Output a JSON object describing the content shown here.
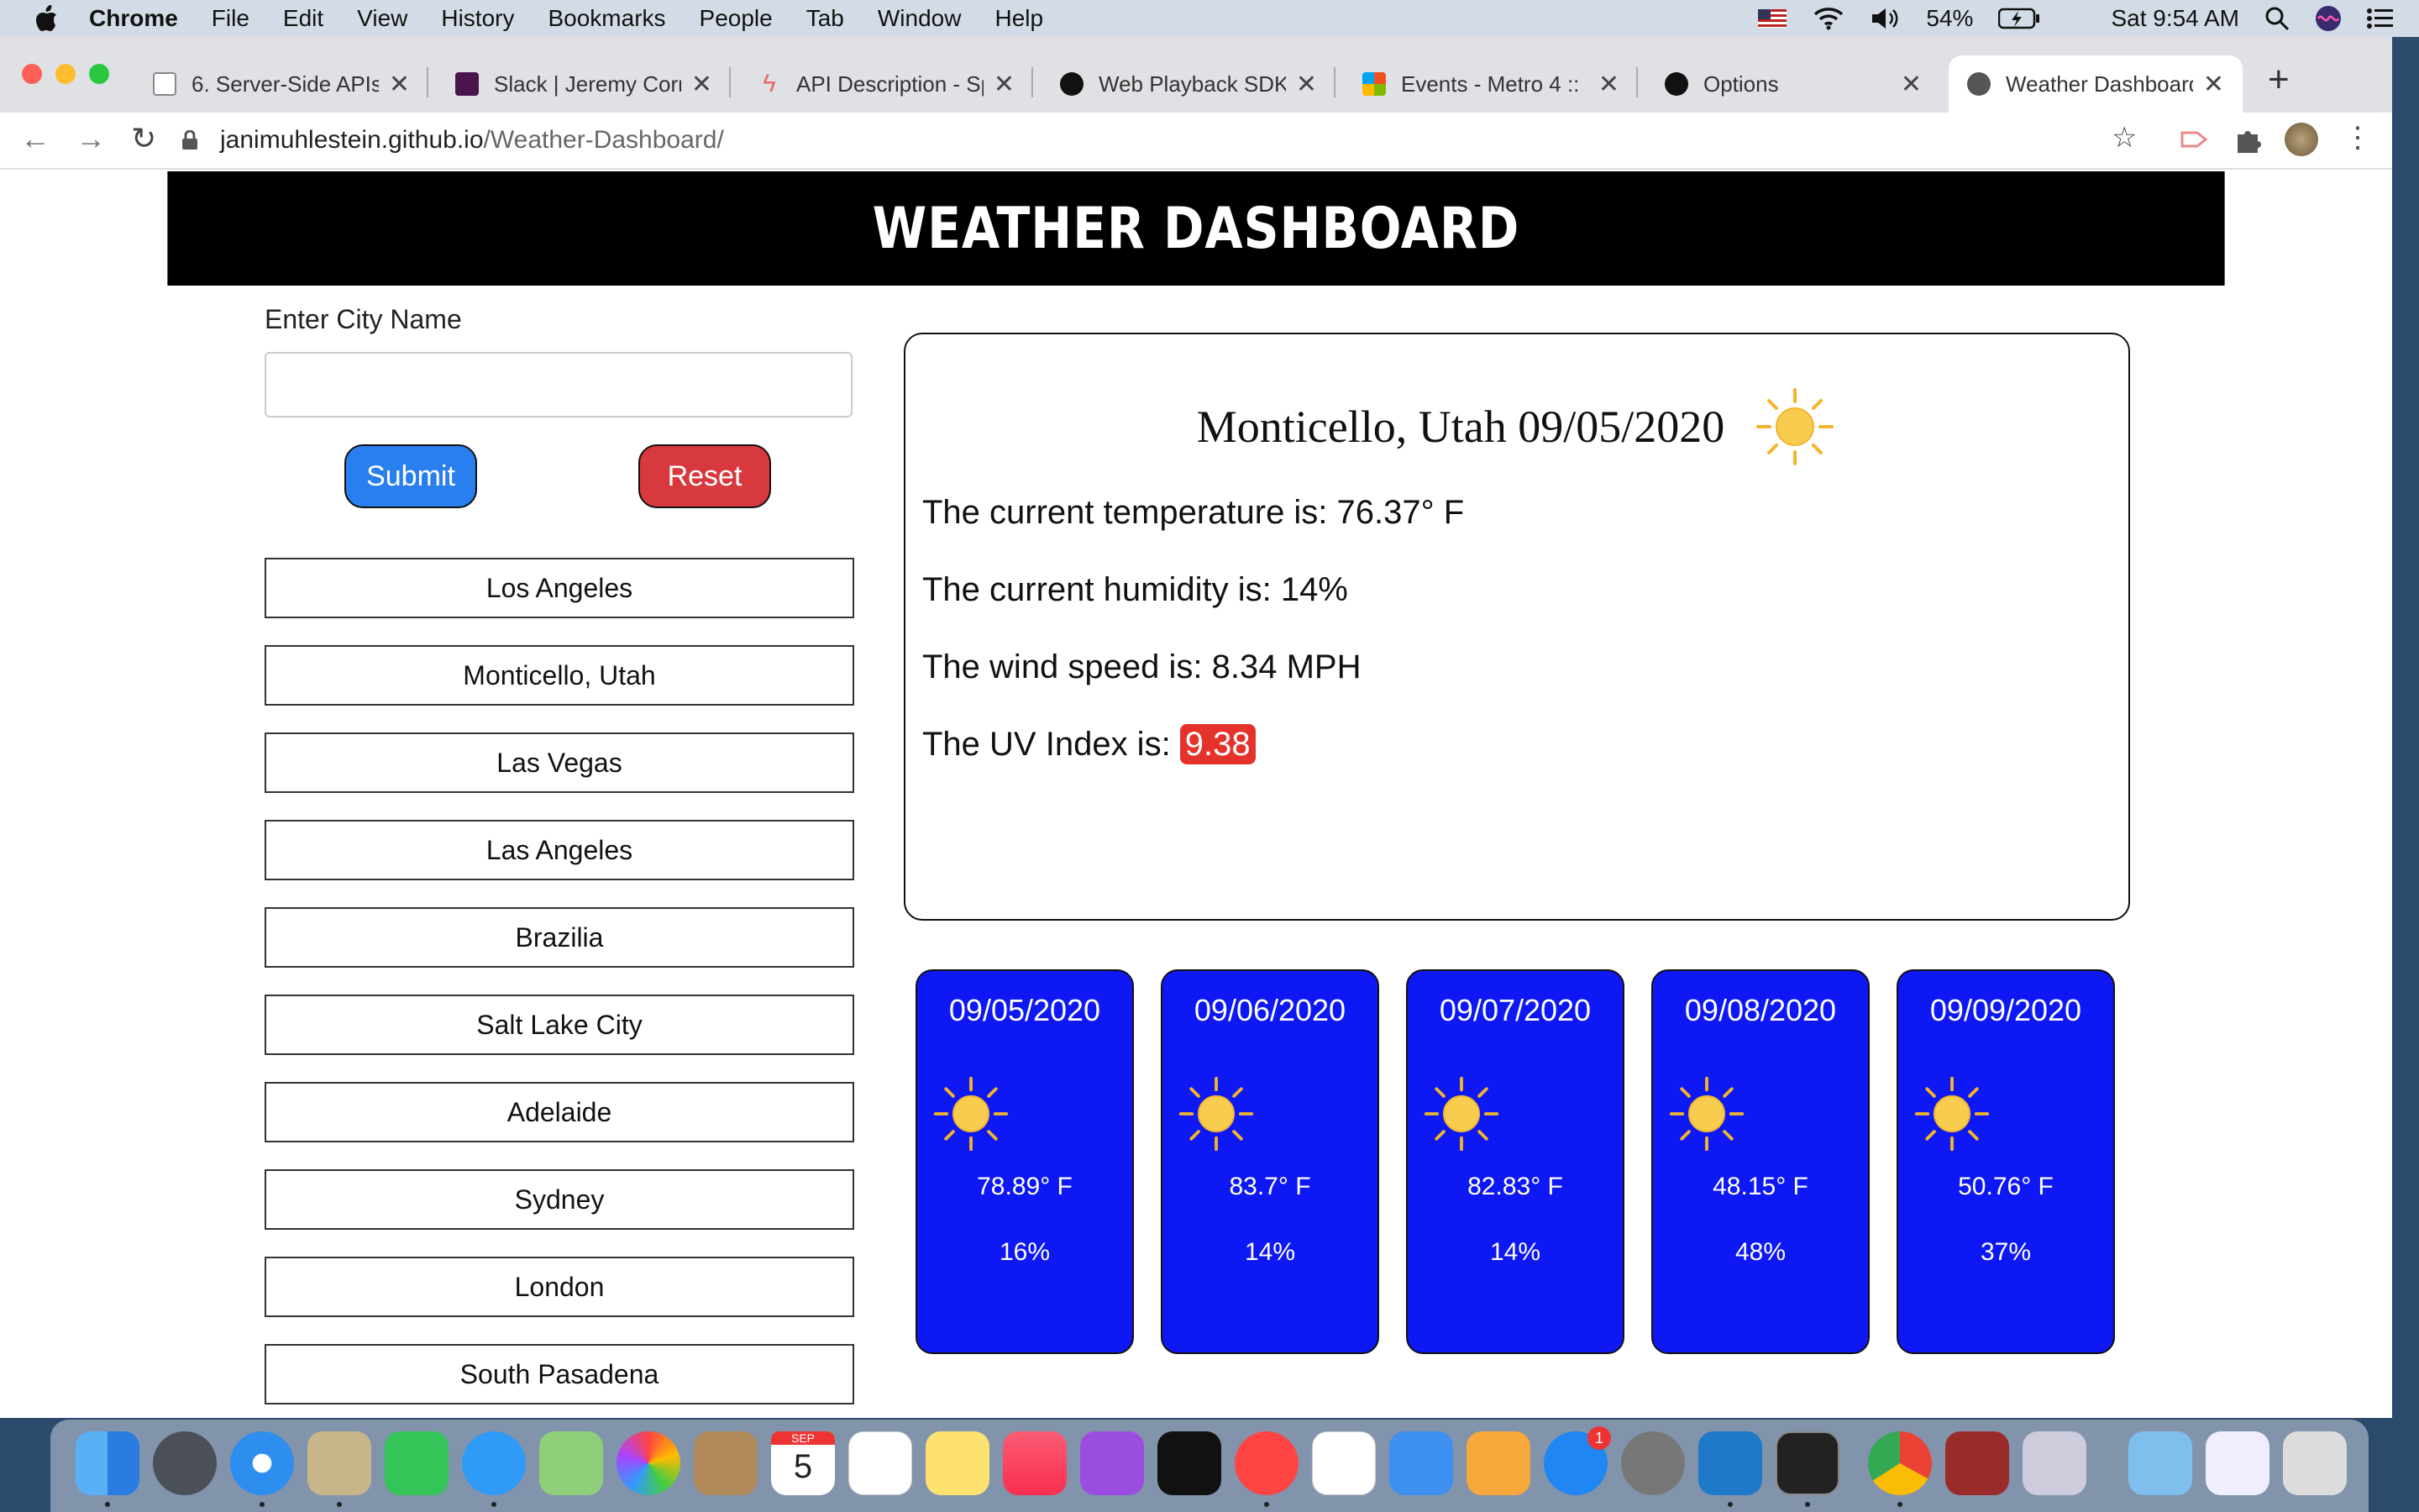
{
  "menubar": {
    "app": "Chrome",
    "items": [
      "File",
      "Edit",
      "View",
      "History",
      "Bookmarks",
      "People",
      "Tab",
      "Window",
      "Help"
    ],
    "battery": "54%",
    "clock": "Sat 9:54 AM"
  },
  "browser": {
    "tabs": [
      {
        "title": "6. Server-Side APIs",
        "icon": "u-icon",
        "active": false
      },
      {
        "title": "Slack | Jeremy Corn",
        "icon": "slack-icon",
        "active": false
      },
      {
        "title": "API Description - Sp",
        "icon": "lightning-icon",
        "active": false
      },
      {
        "title": "Web Playback SDK",
        "icon": "spotify-icon",
        "active": false
      },
      {
        "title": "Events - Metro 4 ::",
        "icon": "metro-icon",
        "active": false
      },
      {
        "title": "Options",
        "icon": "github-icon",
        "active": false
      },
      {
        "title": "Weather Dashboard",
        "icon": "globe-icon",
        "active": true
      }
    ],
    "url_host": "janimuhlestein.github.io",
    "url_path": "/Weather-Dashboard/"
  },
  "page": {
    "header": "WEATHER DASHBOARD",
    "city_label": "Enter City Name",
    "city_input_value": "",
    "submit_label": "Submit",
    "reset_label": "Reset",
    "history": [
      "Los Angeles",
      "Monticello, Utah",
      "Las Vegas",
      "Las Angeles",
      "Brazilia",
      "Salt Lake City",
      "Adelaide",
      "Sydney",
      "London",
      "South Pasadena"
    ],
    "current": {
      "title": "Monticello, Utah 09/05/2020",
      "icon": "sun-icon",
      "temperature": "The current temperature is: 76.37° F",
      "humidity": "The current humidity is: 14%",
      "wind": "The wind speed is: 8.34 MPH",
      "uv_label": "The UV Index is: ",
      "uv_value": "9.38",
      "uv_color": "#e5322b"
    },
    "forecast": [
      {
        "date": "09/05/2020",
        "icon": "sun-icon",
        "temp": "78.89° F",
        "humidity": "16%"
      },
      {
        "date": "09/06/2020",
        "icon": "sun-icon",
        "temp": "83.7° F",
        "humidity": "14%"
      },
      {
        "date": "09/07/2020",
        "icon": "sun-icon",
        "temp": "82.83° F",
        "humidity": "14%"
      },
      {
        "date": "09/08/2020",
        "icon": "sun-icon",
        "temp": "48.15° F",
        "humidity": "48%"
      },
      {
        "date": "09/09/2020",
        "icon": "sun-icon",
        "temp": "50.76° F",
        "humidity": "37%"
      }
    ],
    "forecast_color": "#0d18f5"
  },
  "dock": {
    "calendar_month": "SEP",
    "calendar_day": "5",
    "appstore_badge": "1"
  }
}
